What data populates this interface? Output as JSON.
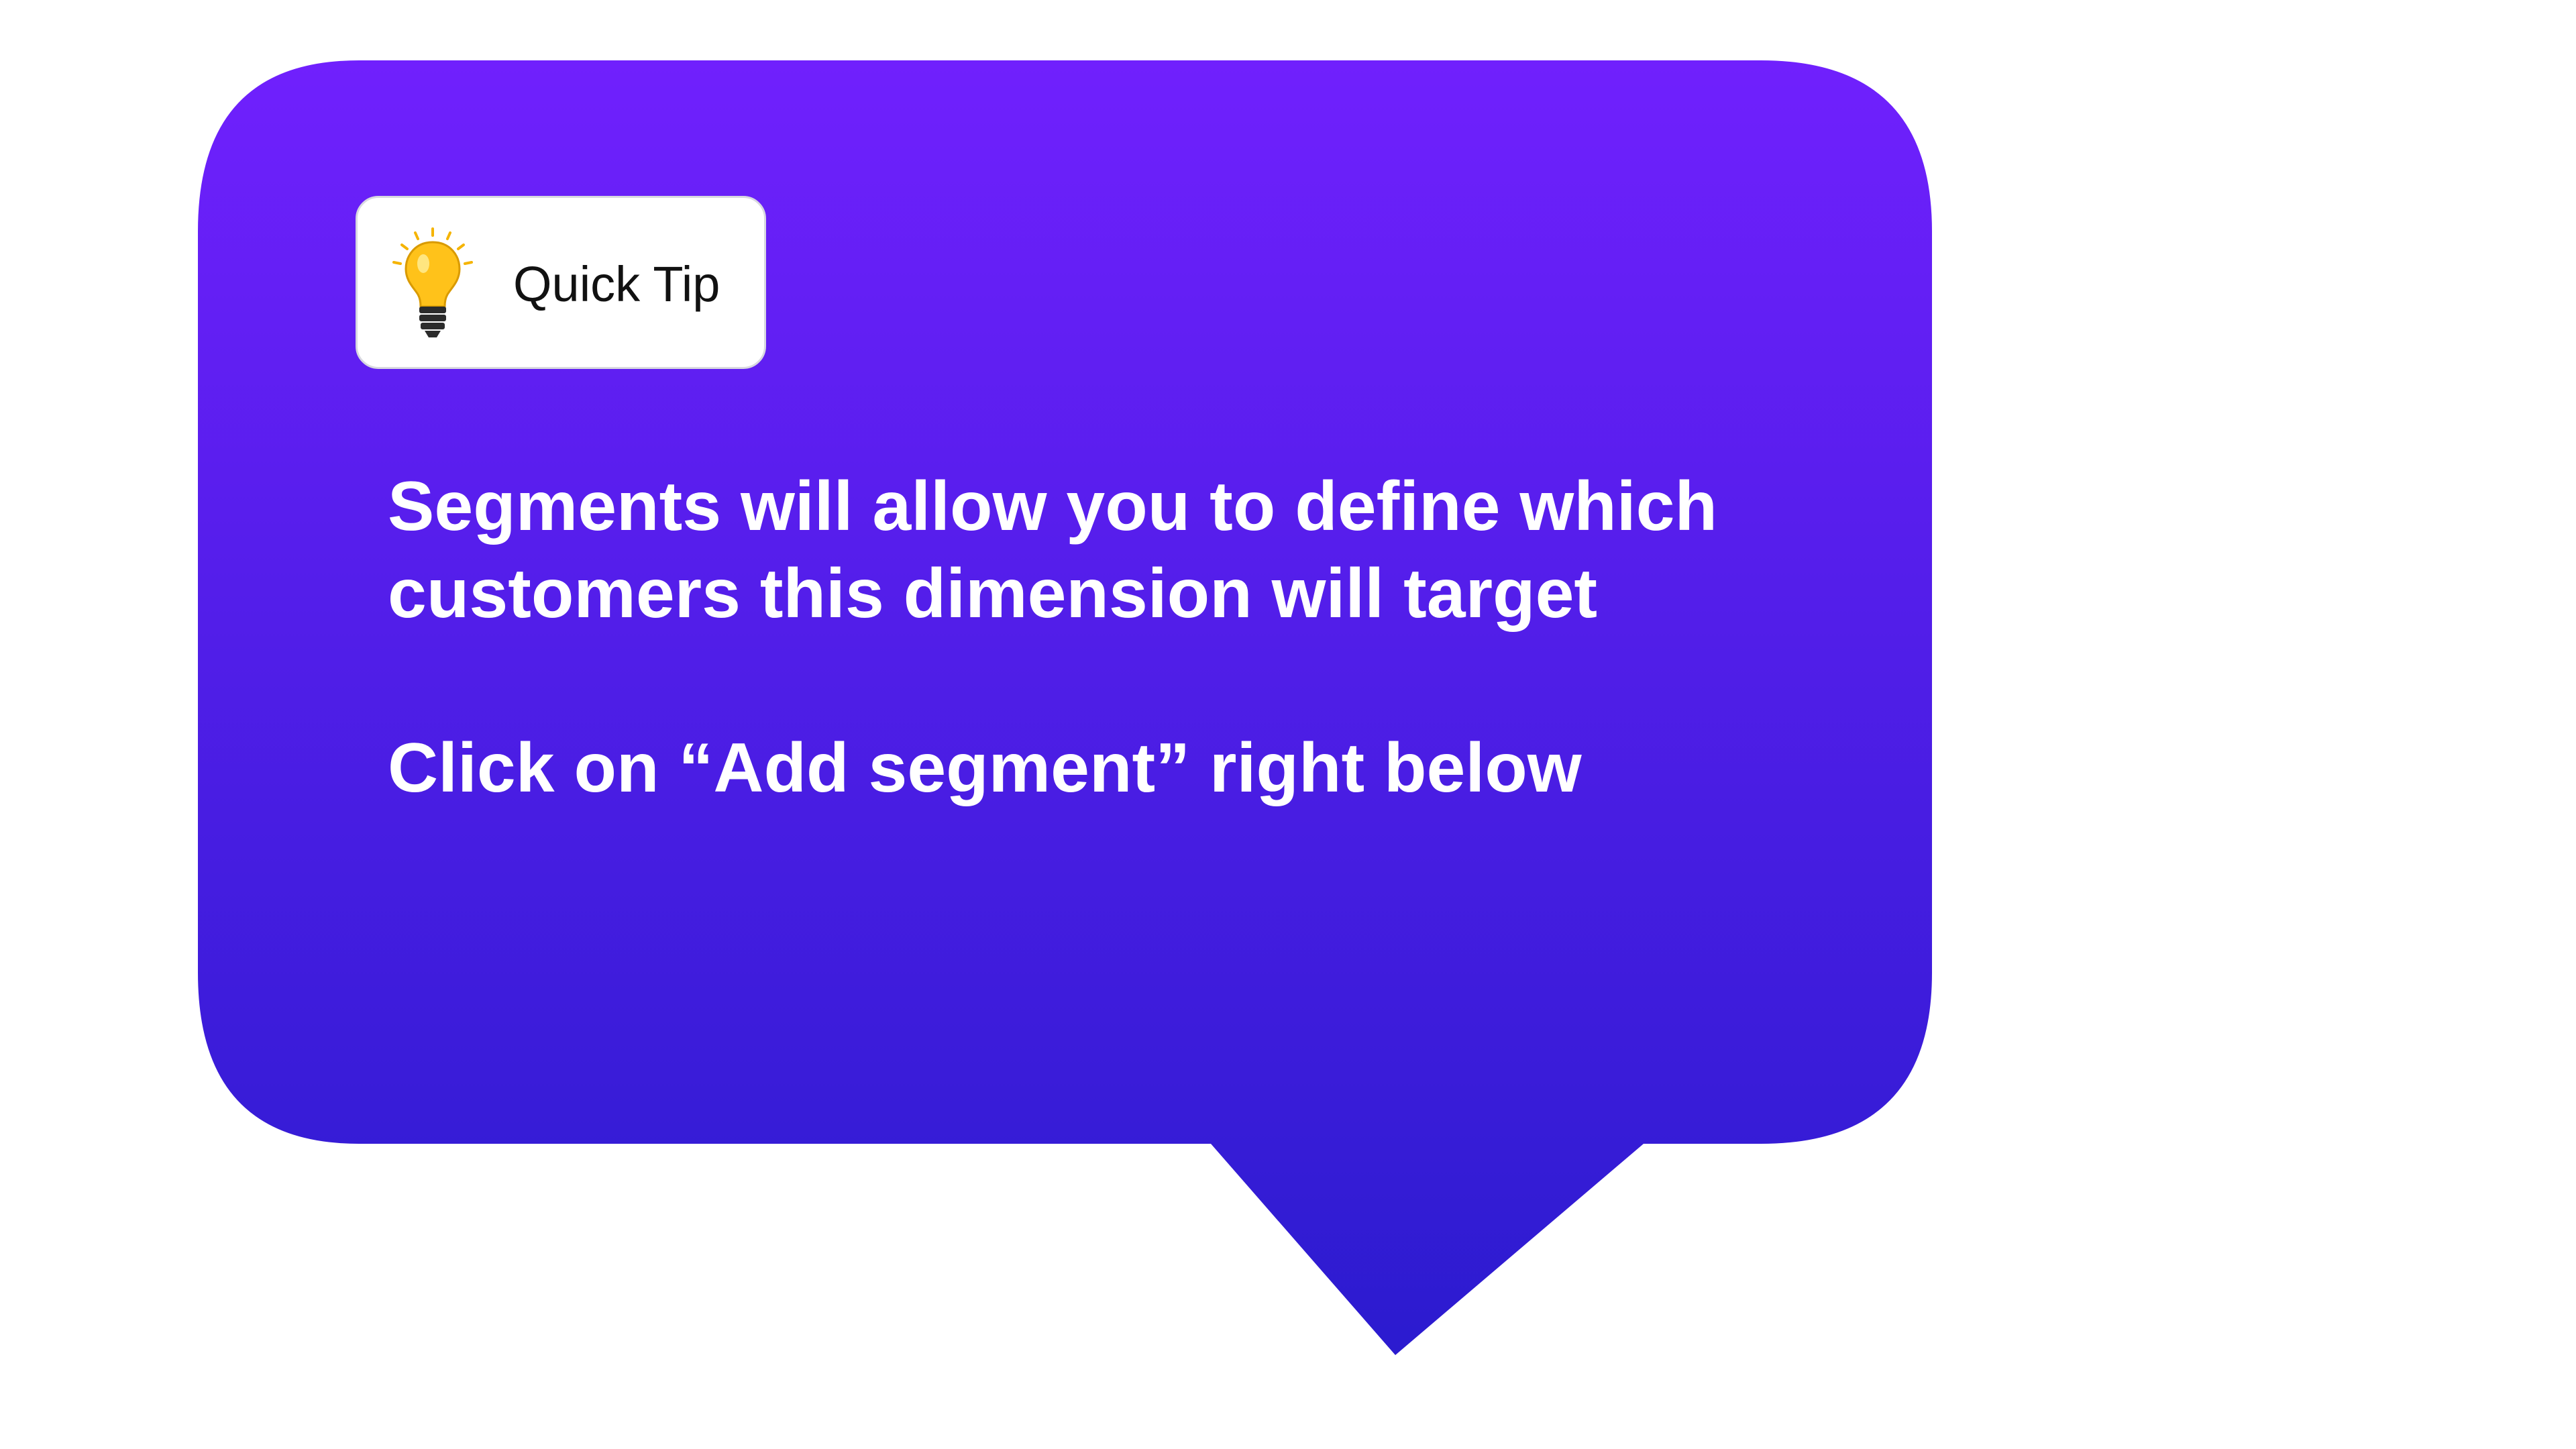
{
  "colors": {
    "bubble_top": "#7020fd",
    "bubble_bottom": "#2b1bcf",
    "badge_background": "#ffffff",
    "message_text": "#ffffff",
    "bulb_glass": "#ffc21a",
    "bulb_base": "#2b2b2b"
  },
  "badge": {
    "icon": "lightbulb-icon",
    "label": "Quick Tip"
  },
  "message": {
    "line1": "Segments will allow you to define which",
    "line2": "customers this dimension will target",
    "line3": "Click on “Add segment” right below"
  }
}
